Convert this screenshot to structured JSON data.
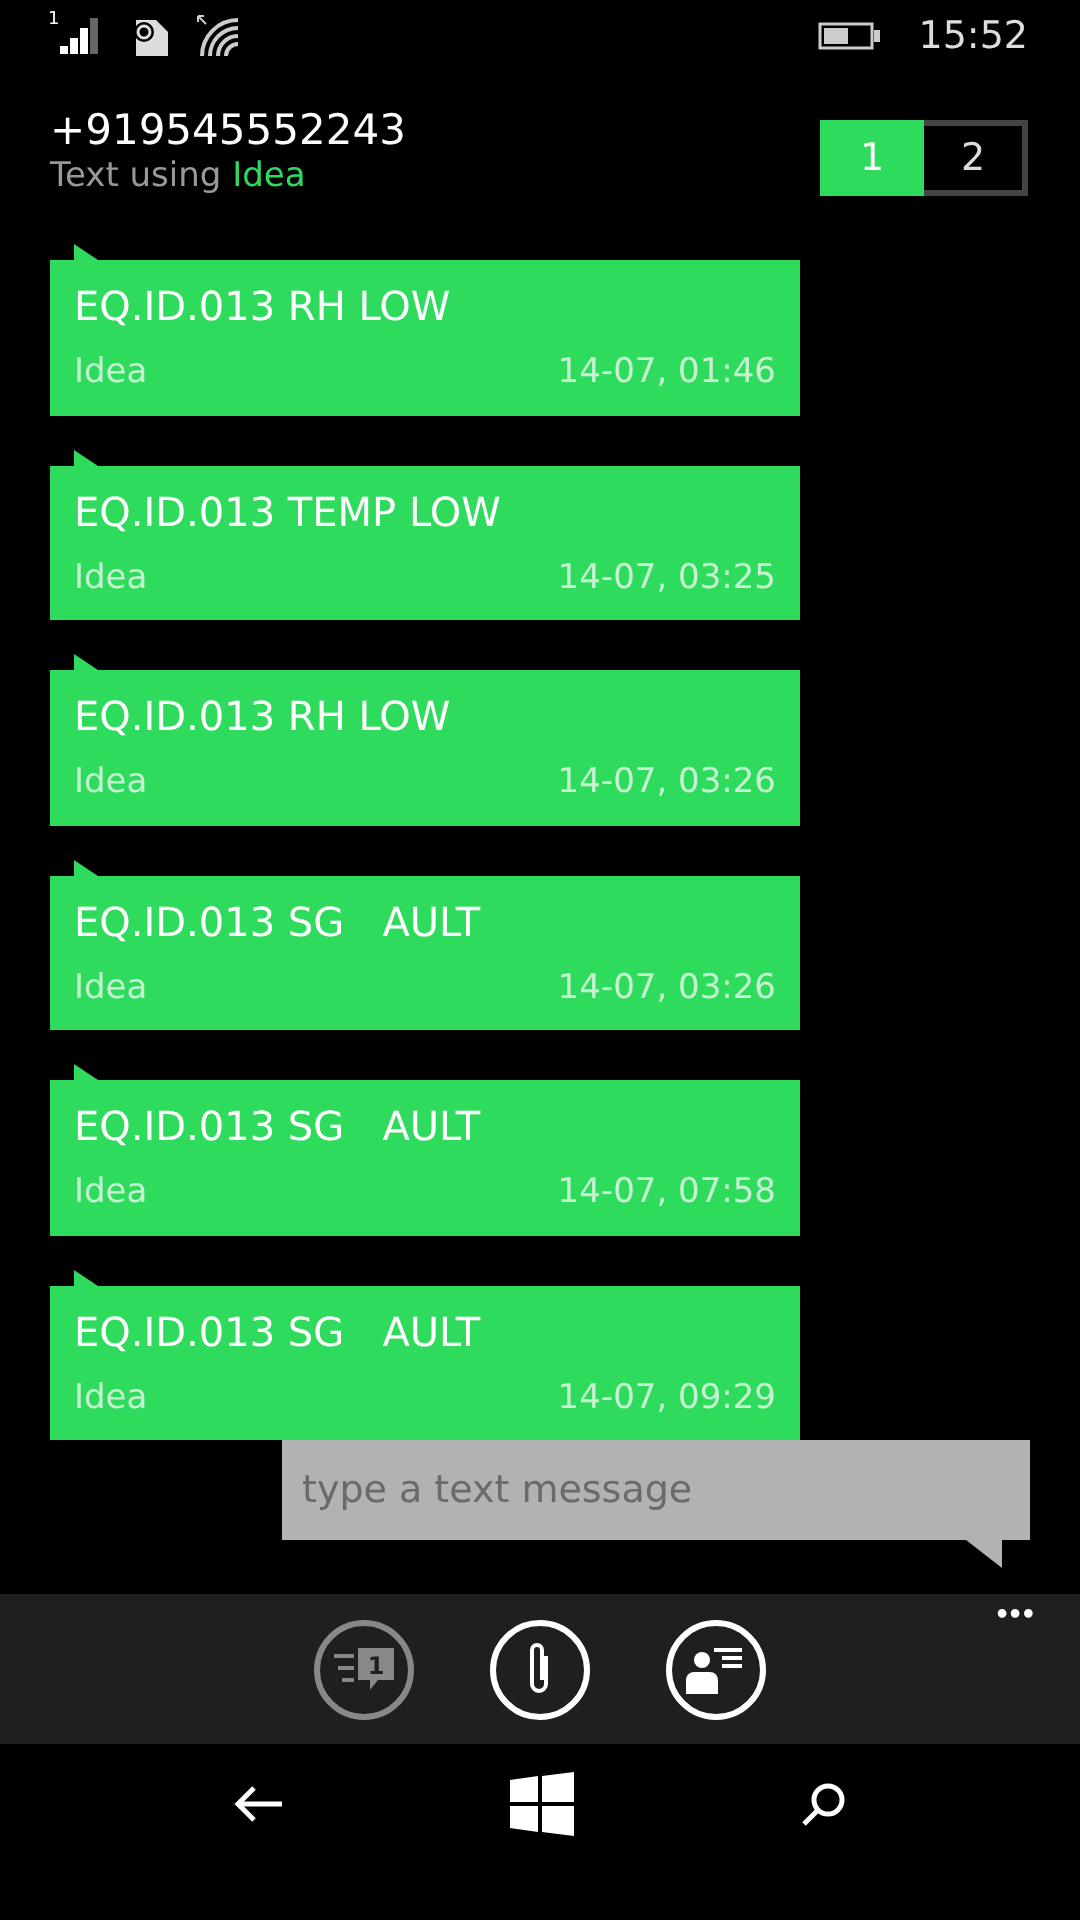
{
  "status_bar": {
    "sim_number": "1",
    "time": "15:52"
  },
  "header": {
    "phone": "+919545552243",
    "subtitle": "Text using ",
    "carrier": "Idea"
  },
  "sim_tabs": [
    {
      "label": "1",
      "selected": true
    },
    {
      "label": "2",
      "selected": false
    }
  ],
  "messages": [
    {
      "text": "EQ.ID.013 RH LOW",
      "carrier": "Idea",
      "time": "14-07, 01:46"
    },
    {
      "text": "EQ.ID.013 TEMP LOW",
      "carrier": "Idea",
      "time": "14-07, 03:25"
    },
    {
      "text": "EQ.ID.013 RH LOW",
      "carrier": "Idea",
      "time": "14-07, 03:26"
    },
    {
      "text": "EQ.ID.013 SG   AULT",
      "carrier": "Idea",
      "time": "14-07, 03:26"
    },
    {
      "text": "EQ.ID.013 SG   AULT",
      "carrier": "Idea",
      "time": "14-07, 07:58"
    },
    {
      "text": "EQ.ID.013 SG   AULT",
      "carrier": "Idea",
      "time": "14-07, 09:29"
    }
  ],
  "compose": {
    "placeholder": "type a text message"
  },
  "app_bar": {
    "buttons": [
      {
        "kind": "switch",
        "disabled": true,
        "badge": "1"
      },
      {
        "kind": "attach",
        "disabled": false
      },
      {
        "kind": "contact",
        "disabled": false
      }
    ],
    "more": "•••"
  }
}
